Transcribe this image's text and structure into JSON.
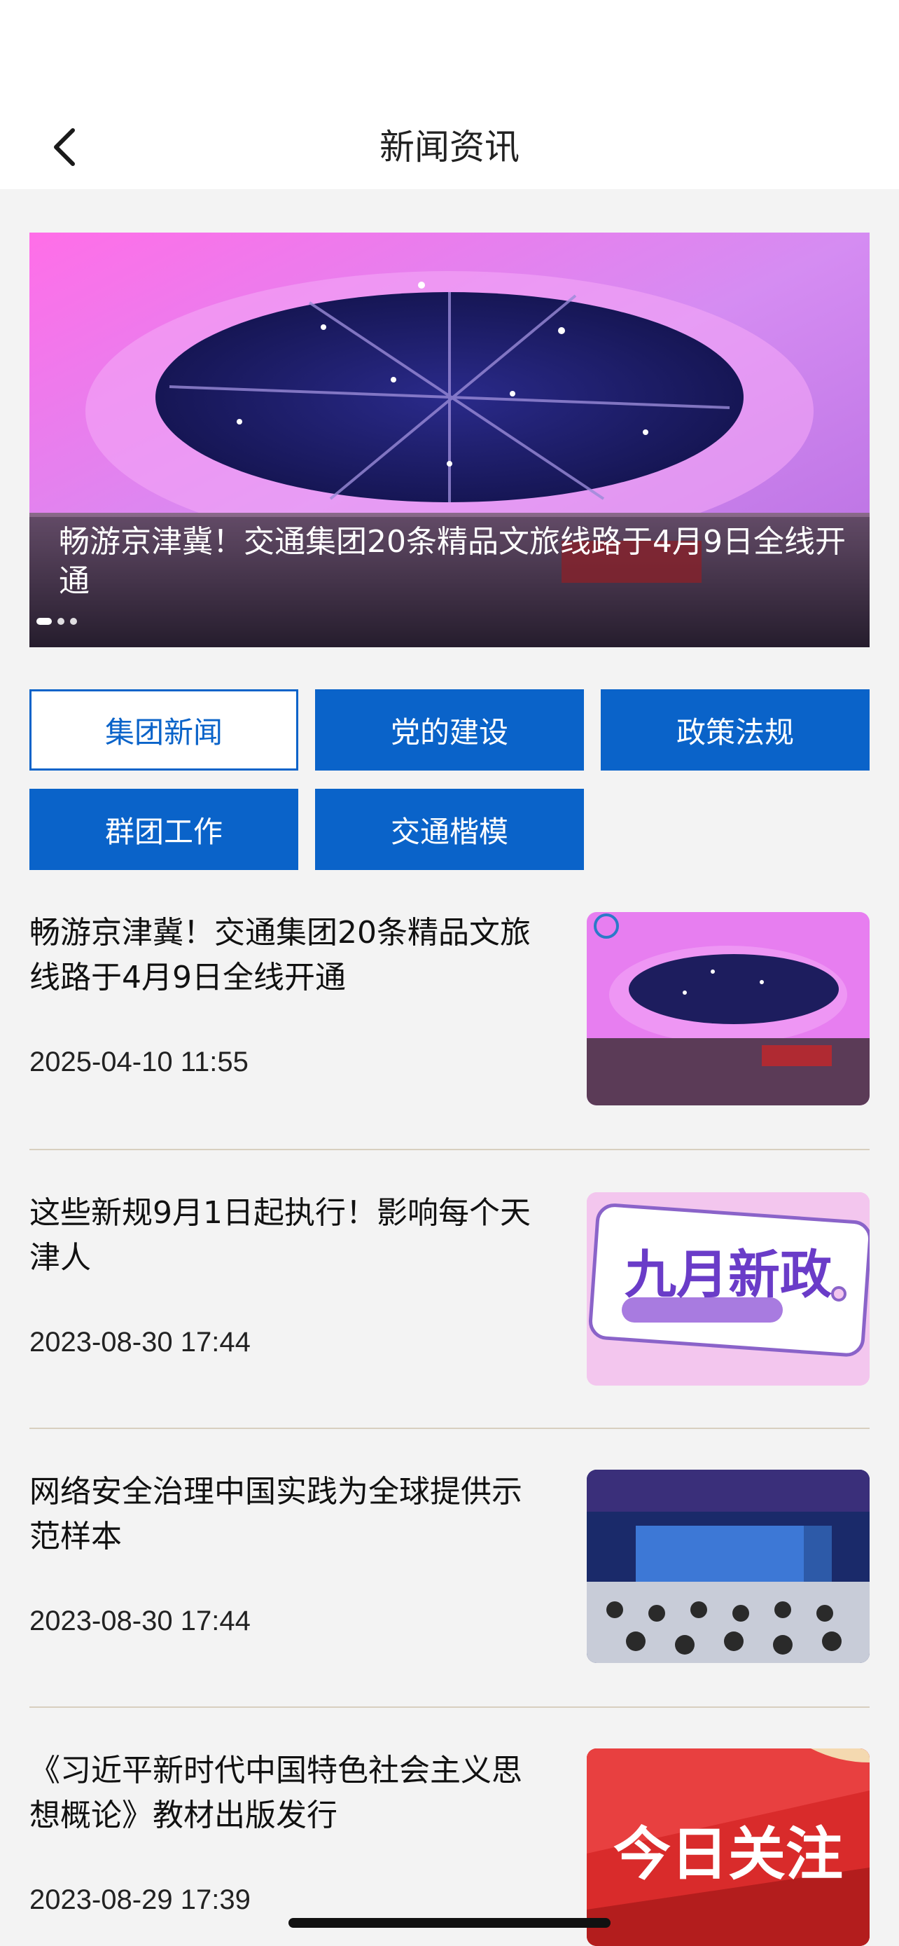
{
  "header": {
    "title": "新闻资讯",
    "back_icon": "chevron-left-icon"
  },
  "banner": {
    "title": "畅游京津冀！交通集团20条精品文旅线路于4月9日全线开通",
    "slides": 3,
    "active_slide": 1
  },
  "categories": [
    {
      "label": "集团新闻",
      "active": true
    },
    {
      "label": "党的建设",
      "active": false
    },
    {
      "label": "政策法规",
      "active": false
    },
    {
      "label": "群团工作",
      "active": false
    },
    {
      "label": "交通楷模",
      "active": false
    }
  ],
  "news": [
    {
      "title": "畅游京津冀！交通集团20条精品文旅线路于4月9日全线开通",
      "date": "2025-04-10 11:55"
    },
    {
      "title": "这些新规9月1日起执行！影响每个天津人",
      "date": "2023-08-30 17:44",
      "thumb_text": "九月新政"
    },
    {
      "title": "网络安全治理中国实践为全球提供示范样本",
      "date": "2023-08-30 17:44"
    },
    {
      "title": "《习近平新时代中国特色社会主义思想概论》教材出版发行",
      "date": "2023-08-29 17:39",
      "thumb_text": "今日关注"
    }
  ],
  "colors": {
    "accent": "#0a63c9",
    "background": "#f3f3f3"
  }
}
